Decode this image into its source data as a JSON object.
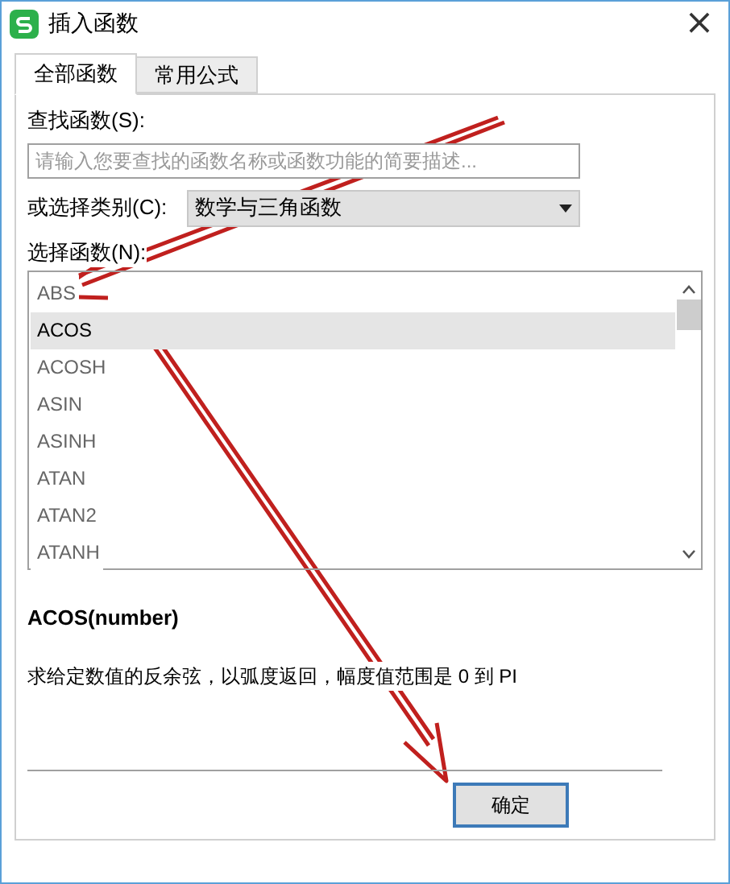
{
  "window": {
    "title": "插入函数",
    "close": "×"
  },
  "tabs": [
    {
      "label": "全部函数",
      "selected": true
    },
    {
      "label": "常用公式",
      "selected": false
    }
  ],
  "search": {
    "label": "查找函数(S):",
    "placeholder": "请输入您要查找的函数名称或函数功能的简要描述..."
  },
  "category": {
    "label": "或选择类别(C):",
    "value": "数学与三角函数"
  },
  "functions": {
    "label": "选择函数(N):",
    "items": [
      {
        "name": "ABS",
        "selected": false
      },
      {
        "name": "ACOS",
        "selected": true
      },
      {
        "name": "ACOSH",
        "selected": false
      },
      {
        "name": "ASIN",
        "selected": false
      },
      {
        "name": "ASINH",
        "selected": false
      },
      {
        "name": "ATAN",
        "selected": false
      },
      {
        "name": "ATAN2",
        "selected": false
      },
      {
        "name": "ATANH",
        "selected": false
      }
    ]
  },
  "signature": "ACOS(number)",
  "description": "求给定数值的反余弦，以弧度返回，幅度值范围是 0 到 PI",
  "buttons": [
    "确定"
  ]
}
